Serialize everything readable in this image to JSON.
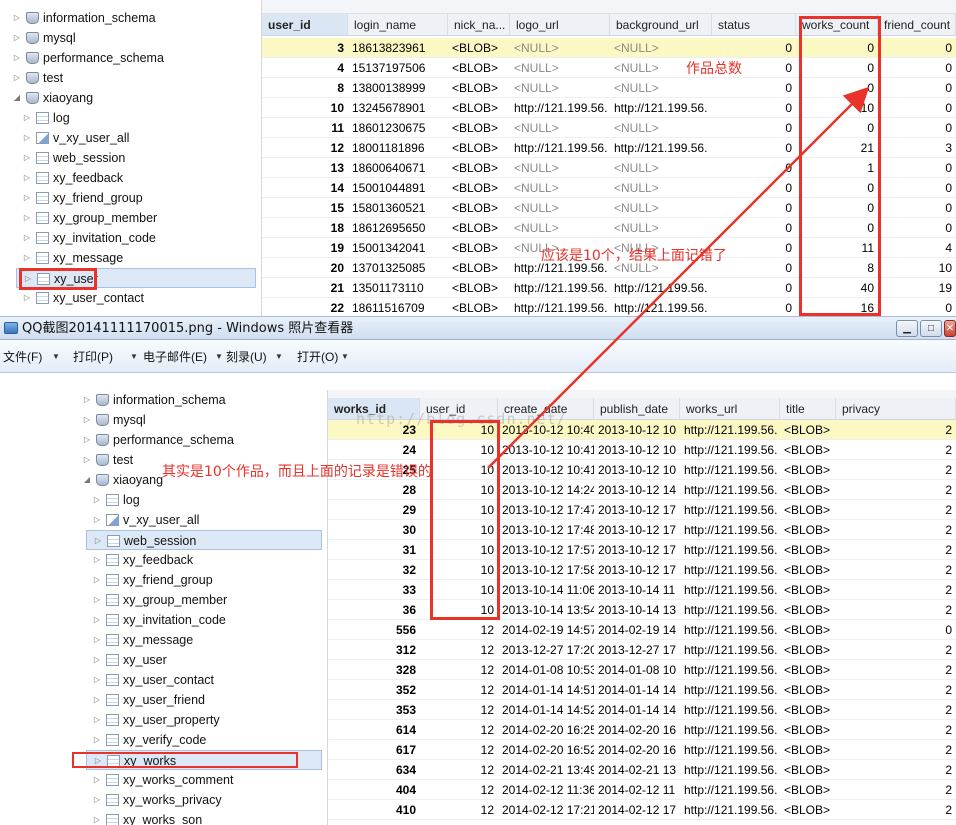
{
  "top": {
    "tree": [
      {
        "label": "information_schema",
        "icon": "db",
        "exp": "▷"
      },
      {
        "label": "mysql",
        "icon": "db",
        "exp": "▷"
      },
      {
        "label": "performance_schema",
        "icon": "db",
        "exp": "▷"
      },
      {
        "label": "test",
        "icon": "db",
        "exp": "▷"
      },
      {
        "label": "xiaoyang",
        "icon": "db",
        "exp": "◢"
      },
      {
        "label": "log",
        "icon": "table",
        "exp": "▷",
        "child": true
      },
      {
        "label": "v_xy_user_all",
        "icon": "view",
        "exp": "▷",
        "child": true
      },
      {
        "label": "web_session",
        "icon": "table",
        "exp": "▷",
        "child": true
      },
      {
        "label": "xy_feedback",
        "icon": "table",
        "exp": "▷",
        "child": true
      },
      {
        "label": "xy_friend_group",
        "icon": "table",
        "exp": "▷",
        "child": true
      },
      {
        "label": "xy_group_member",
        "icon": "table",
        "exp": "▷",
        "child": true
      },
      {
        "label": "xy_invitation_code",
        "icon": "table",
        "exp": "▷",
        "child": true
      },
      {
        "label": "xy_message",
        "icon": "table",
        "exp": "▷",
        "child": true
      },
      {
        "label": "xy_user",
        "icon": "table",
        "exp": "▷",
        "child": true,
        "selected": true
      },
      {
        "label": "xy_user_contact",
        "icon": "table",
        "exp": "▷",
        "child": true
      }
    ],
    "columns": [
      "user_id",
      "login_name",
      "nick_na...",
      "logo_url",
      "background_url",
      "status",
      "works_count",
      "friend_count"
    ],
    "rows": [
      [
        "3",
        "18613823961",
        "<BLOB>",
        "<NULL>",
        "<NULL>",
        "0",
        "0",
        "0"
      ],
      [
        "4",
        "15137197506",
        "<BLOB>",
        "<NULL>",
        "<NULL>",
        "0",
        "0",
        "0"
      ],
      [
        "8",
        "13800138999",
        "<BLOB>",
        "<NULL>",
        "<NULL>",
        "0",
        "0",
        "0"
      ],
      [
        "10",
        "13245678901",
        "<BLOB>",
        "http://121.199.56.",
        "http://121.199.56.",
        "0",
        "10",
        "0"
      ],
      [
        "11",
        "18601230675",
        "<BLOB>",
        "<NULL>",
        "<NULL>",
        "0",
        "0",
        "0"
      ],
      [
        "12",
        "18001181896",
        "<BLOB>",
        "http://121.199.56.",
        "http://121.199.56.",
        "0",
        "21",
        "3"
      ],
      [
        "13",
        "18600640671",
        "<BLOB>",
        "<NULL>",
        "<NULL>",
        "0",
        "1",
        "0"
      ],
      [
        "14",
        "15001044891",
        "<BLOB>",
        "<NULL>",
        "<NULL>",
        "0",
        "0",
        "0"
      ],
      [
        "15",
        "15801360521",
        "<BLOB>",
        "<NULL>",
        "<NULL>",
        "0",
        "0",
        "0"
      ],
      [
        "18",
        "18612695650",
        "<BLOB>",
        "<NULL>",
        "<NULL>",
        "0",
        "0",
        "0"
      ],
      [
        "19",
        "15001342041",
        "<BLOB>",
        "<NULL>",
        "<NULL>",
        "0",
        "11",
        "4"
      ],
      [
        "20",
        "13701325085",
        "<BLOB>",
        "http://121.199.56.",
        "<NULL>",
        "0",
        "8",
        "10"
      ],
      [
        "21",
        "13501173110",
        "<BLOB>",
        "http://121.199.56.",
        "http://121.199.56.",
        "0",
        "40",
        "19"
      ],
      [
        "22",
        "18611516709",
        "<BLOB>",
        "http://121.199.56.",
        "http://121.199.56.",
        "0",
        "16",
        "0"
      ]
    ]
  },
  "viewer": {
    "title": "QQ截图20141111170015.png - Windows 照片查看器",
    "menu": [
      "文件(F)",
      "打印(P)",
      "电子邮件(E)",
      "刻录(U)",
      "打开(O)"
    ],
    "btn_min": "▁",
    "btn_max": "□",
    "btn_close": "✕"
  },
  "bottom": {
    "tree": [
      {
        "label": "information_schema",
        "icon": "db",
        "exp": "▷"
      },
      {
        "label": "mysql",
        "icon": "db",
        "exp": "▷"
      },
      {
        "label": "performance_schema",
        "icon": "db",
        "exp": "▷"
      },
      {
        "label": "test",
        "icon": "db",
        "exp": "▷"
      },
      {
        "label": "xiaoyang",
        "icon": "db",
        "exp": "◢"
      },
      {
        "label": "log",
        "icon": "table",
        "exp": "▷",
        "child": true
      },
      {
        "label": "v_xy_user_all",
        "icon": "view",
        "exp": "▷",
        "child": true
      },
      {
        "label": "web_session",
        "icon": "table",
        "exp": "▷",
        "child": true,
        "selected": true
      },
      {
        "label": "xy_feedback",
        "icon": "table",
        "exp": "▷",
        "child": true
      },
      {
        "label": "xy_friend_group",
        "icon": "table",
        "exp": "▷",
        "child": true
      },
      {
        "label": "xy_group_member",
        "icon": "table",
        "exp": "▷",
        "child": true
      },
      {
        "label": "xy_invitation_code",
        "icon": "table",
        "exp": "▷",
        "child": true
      },
      {
        "label": "xy_message",
        "icon": "table",
        "exp": "▷",
        "child": true
      },
      {
        "label": "xy_user",
        "icon": "table",
        "exp": "▷",
        "child": true
      },
      {
        "label": "xy_user_contact",
        "icon": "table",
        "exp": "▷",
        "child": true
      },
      {
        "label": "xy_user_friend",
        "icon": "table",
        "exp": "▷",
        "child": true
      },
      {
        "label": "xy_user_property",
        "icon": "table",
        "exp": "▷",
        "child": true
      },
      {
        "label": "xy_verify_code",
        "icon": "table",
        "exp": "▷",
        "child": true
      },
      {
        "label": "xy_works",
        "icon": "table",
        "exp": "▷",
        "child": true,
        "selected": true
      },
      {
        "label": "xy_works_comment",
        "icon": "table",
        "exp": "▷",
        "child": true
      },
      {
        "label": "xy_works_privacy",
        "icon": "table",
        "exp": "▷",
        "child": true
      },
      {
        "label": "xy_works_son",
        "icon": "table",
        "exp": "▷",
        "child": true
      }
    ],
    "columns": [
      "works_id",
      "user_id",
      "create_date",
      "publish_date",
      "works_url",
      "title",
      "privacy"
    ],
    "rows": [
      [
        "23",
        "10",
        "2013-10-12 10:40",
        "2013-10-12 10",
        "http://121.199.56.",
        "<BLOB>",
        "2"
      ],
      [
        "24",
        "10",
        "2013-10-12 10:41",
        "2013-10-12 10",
        "http://121.199.56.",
        "<BLOB>",
        "2"
      ],
      [
        "25",
        "10",
        "2013-10-12 10:41",
        "2013-10-12 10",
        "http://121.199.56.",
        "<BLOB>",
        "2"
      ],
      [
        "28",
        "10",
        "2013-10-12 14:24",
        "2013-10-12 14",
        "http://121.199.56.",
        "<BLOB>",
        "2"
      ],
      [
        "29",
        "10",
        "2013-10-12 17:47",
        "2013-10-12 17",
        "http://121.199.56.",
        "<BLOB>",
        "2"
      ],
      [
        "30",
        "10",
        "2013-10-12 17:48",
        "2013-10-12 17",
        "http://121.199.56.",
        "<BLOB>",
        "2"
      ],
      [
        "31",
        "10",
        "2013-10-12 17:57",
        "2013-10-12 17",
        "http://121.199.56.",
        "<BLOB>",
        "2"
      ],
      [
        "32",
        "10",
        "2013-10-12 17:58",
        "2013-10-12 17",
        "http://121.199.56.",
        "<BLOB>",
        "2"
      ],
      [
        "33",
        "10",
        "2013-10-14 11:06",
        "2013-10-14 11",
        "http://121.199.56.",
        "<BLOB>",
        "2"
      ],
      [
        "36",
        "10",
        "2013-10-14 13:54",
        "2013-10-14 13",
        "http://121.199.56.",
        "<BLOB>",
        "2"
      ],
      [
        "556",
        "12",
        "2014-02-19 14:57",
        "2014-02-19 14",
        "http://121.199.56.",
        "<BLOB>",
        "0"
      ],
      [
        "312",
        "12",
        "2013-12-27 17:20",
        "2013-12-27 17",
        "http://121.199.56.",
        "<BLOB>",
        "2"
      ],
      [
        "328",
        "12",
        "2014-01-08 10:53",
        "2014-01-08 10",
        "http://121.199.56.",
        "<BLOB>",
        "2"
      ],
      [
        "352",
        "12",
        "2014-01-14 14:51",
        "2014-01-14 14",
        "http://121.199.56.",
        "<BLOB>",
        "2"
      ],
      [
        "353",
        "12",
        "2014-01-14 14:52",
        "2014-01-14 14",
        "http://121.199.56.",
        "<BLOB>",
        "2"
      ],
      [
        "614",
        "12",
        "2014-02-20 16:25",
        "2014-02-20 16",
        "http://121.199.56.",
        "<BLOB>",
        "2"
      ],
      [
        "617",
        "12",
        "2014-02-20 16:52",
        "2014-02-20 16",
        "http://121.199.56.",
        "<BLOB>",
        "2"
      ],
      [
        "634",
        "12",
        "2014-02-21 13:49",
        "2014-02-21 13",
        "http://121.199.56.",
        "<BLOB>",
        "2"
      ],
      [
        "404",
        "12",
        "2014-02-12 11:36",
        "2014-02-12 11",
        "http://121.199.56.",
        "<BLOB>",
        "2"
      ],
      [
        "410",
        "12",
        "2014-02-12 17:21",
        "2014-02-12 17",
        "http://121.199.56.",
        "<BLOB>",
        "2"
      ]
    ]
  },
  "annotations": {
    "works_total": "作品总数",
    "should_be_10": "应该是10个，结果上面记错了",
    "actually_10": "其实是10个作品，而且上面的记录是错误的"
  },
  "watermark": "http://blog.csdn.net/"
}
